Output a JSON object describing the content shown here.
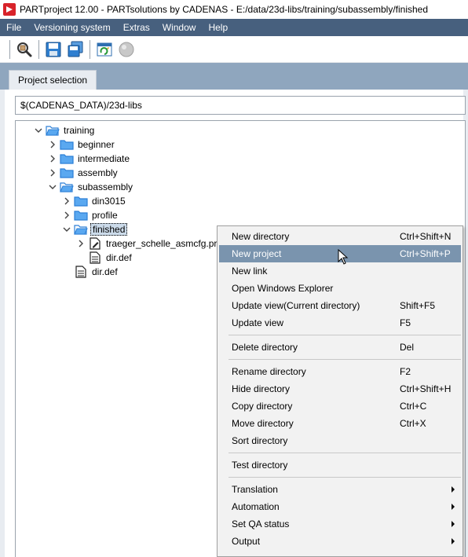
{
  "window": {
    "title": "PARTproject 12.00 - PARTsolutions by CADENAS - E:/data/23d-libs/training/subassembly/finished"
  },
  "menubar": {
    "items": [
      "File",
      "Versioning system",
      "Extras",
      "Window",
      "Help"
    ]
  },
  "toolbar": {
    "buttons": [
      "search-icon",
      "save-icon",
      "save-all-icon",
      "refresh-icon",
      "globe-icon"
    ]
  },
  "tabs": {
    "active": "Project selection"
  },
  "path_field": {
    "value": "$(CADENAS_DATA)/23d-libs"
  },
  "tree": {
    "nodes": [
      {
        "label": "training",
        "type": "folder-open",
        "expander": "down"
      },
      {
        "label": "beginner",
        "type": "folder",
        "expander": "right"
      },
      {
        "label": "intermediate",
        "type": "folder",
        "expander": "right"
      },
      {
        "label": "assembly",
        "type": "folder",
        "expander": "right"
      },
      {
        "label": "subassembly",
        "type": "folder-open",
        "expander": "down"
      },
      {
        "label": "din3015",
        "type": "folder",
        "expander": "right"
      },
      {
        "label": "profile",
        "type": "folder",
        "expander": "right"
      },
      {
        "label": "finished",
        "type": "folder-open",
        "expander": "down",
        "selected": true
      },
      {
        "label": "traeger_schelle_asmcfg.prj",
        "type": "project",
        "expander": "right"
      },
      {
        "label": "dir.def",
        "type": "file",
        "expander": ""
      },
      {
        "label": "dir.def",
        "type": "file",
        "expander": ""
      }
    ]
  },
  "context_menu": {
    "items": [
      {
        "label": "New directory",
        "shortcut": "Ctrl+Shift+N"
      },
      {
        "label": "New project",
        "shortcut": "Ctrl+Shift+P",
        "highlighted": true
      },
      {
        "label": "New link",
        "shortcut": ""
      },
      {
        "label": "Open Windows Explorer",
        "shortcut": ""
      },
      {
        "label": "Update view(Current directory)",
        "shortcut": "Shift+F5"
      },
      {
        "label": "Update view",
        "shortcut": "F5"
      },
      {
        "label": "Delete directory",
        "shortcut": "Del"
      },
      {
        "label": "Rename directory",
        "shortcut": "F2"
      },
      {
        "label": "Hide directory",
        "shortcut": "Ctrl+Shift+H"
      },
      {
        "label": "Copy directory",
        "shortcut": "Ctrl+C"
      },
      {
        "label": "Move directory",
        "shortcut": "Ctrl+X"
      },
      {
        "label": "Sort directory",
        "shortcut": ""
      },
      {
        "label": "Test directory",
        "shortcut": ""
      },
      {
        "label": "Translation",
        "shortcut": "",
        "submenu": true
      },
      {
        "label": "Automation",
        "shortcut": "",
        "submenu": true
      },
      {
        "label": "Set QA status",
        "shortcut": "",
        "submenu": true
      },
      {
        "label": "Output",
        "shortcut": "",
        "submenu": true
      }
    ]
  },
  "colors": {
    "menubar": "#47607e",
    "tabstrip": "#8fa6be",
    "menu_highlight": "#7a94ae",
    "folder": "#3d8ee6"
  }
}
